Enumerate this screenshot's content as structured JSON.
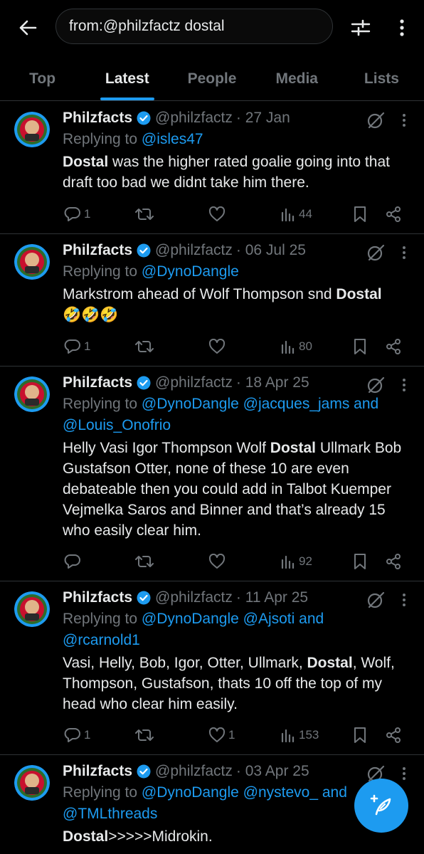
{
  "search": {
    "query": "from:@philzfactz dostal"
  },
  "tabs": [
    "Top",
    "Latest",
    "People",
    "Media",
    "Lists"
  ],
  "active_tab": "Latest",
  "colors": {
    "accent": "#1d9bf0",
    "muted": "#71767b",
    "text": "#e7e9ea",
    "border": "#2f3336"
  },
  "tweets": [
    {
      "name": "Philzfacts",
      "handle": "@philzfactz",
      "date": "· 27 Jan",
      "reply_prefix": "Replying to ",
      "reply_to": "@isles47",
      "reply_to_2": "",
      "text_bold": "Dostal",
      "text_rest": " was the higher rated goalie going into that draft too bad we didnt take him there.",
      "replies": "1",
      "likes": "",
      "views": "44"
    },
    {
      "name": "Philzfacts",
      "handle": "@philzfactz",
      "date": "· 06 Jul 25",
      "reply_prefix": "Replying to ",
      "reply_to": "@DynoDangle",
      "reply_to_2": "",
      "text_pre": "Markstrom ahead of Wolf Thompson snd ",
      "text_bold": "Dostal",
      "text_rest": "🤣🤣🤣",
      "replies": "1",
      "likes": "",
      "views": "80"
    },
    {
      "name": "Philzfacts",
      "handle": "@philzfactz",
      "date": "· 18 Apr 25",
      "reply_prefix": "Replying to ",
      "reply_to": "@DynoDangle @jacques_jams and",
      "reply_to_2": "@Louis_Onofrio",
      "text_pre": "Helly Vasi Igor Thompson Wolf ",
      "text_bold": "Dostal",
      "text_rest": " Ullmark Bob Gustafson Otter, none of these 10 are even debateable then you could add in Talbot Kuemper Vejmelka Saros and Binner and that’s already 15 who easily clear him.",
      "replies": "",
      "likes": "",
      "views": "92"
    },
    {
      "name": "Philzfacts",
      "handle": "@philzfactz",
      "date": "· 11 Apr 25",
      "reply_prefix": "Replying to ",
      "reply_to": "@DynoDangle @Ajsoti and",
      "reply_to_2": "@rcarnold1",
      "text_pre": "Vasi, Helly, Bob, Igor, Otter, Ullmark, ",
      "text_bold": "Dostal",
      "text_rest": ", Wolf, Thompson, Gustafson, thats 10 off the top of my head who clear him easily.",
      "replies": "1",
      "likes": "1",
      "views": "153"
    },
    {
      "name": "Philzfacts",
      "handle": "@philzfactz",
      "date": "· 03 Apr 25",
      "reply_prefix": "Replying to ",
      "reply_to": "@DynoDangle @nystevo_ and",
      "reply_to_2": "@TMLthreads",
      "text_bold": "Dostal",
      "text_rest": ">>>>>Midrokin.",
      "replies": "",
      "likes": "",
      "views": ""
    }
  ]
}
